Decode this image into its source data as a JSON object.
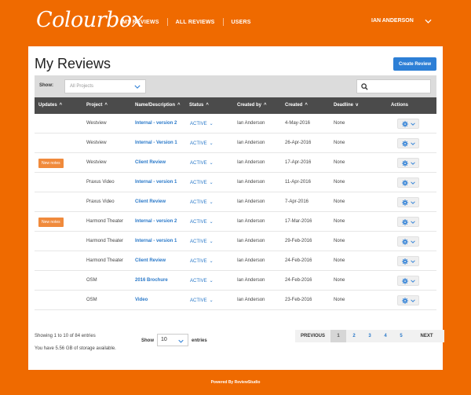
{
  "brand": {
    "logo": "Colourbox"
  },
  "nav": {
    "items": [
      {
        "label": "MY REVIEWS"
      },
      {
        "label": "ALL REVIEWS"
      },
      {
        "label": "USERS"
      }
    ],
    "user_name": "IAN ANDERSON"
  },
  "page": {
    "title": "My Reviews",
    "create_button": "Create Review"
  },
  "filter": {
    "show_label": "Show:",
    "project_placeholder": "All Projects"
  },
  "table": {
    "headers": {
      "updates": "Updates",
      "project": "Project",
      "name": "Name/Description",
      "status": "Status",
      "created_by": "Created by",
      "created": "Created",
      "deadline": "Deadline",
      "actions": "Actions"
    },
    "rows": [
      {
        "badge": "",
        "project": "Westview",
        "name": "Internal - version 2",
        "status": "ACTIVE",
        "created_by": "Ian Anderson",
        "created": "4-May-2016",
        "deadline": "None"
      },
      {
        "badge": "",
        "project": "Westview",
        "name": "Internal - Version 1",
        "status": "ACTIVE",
        "created_by": "Ian Anderson",
        "created": "26-Apr-2016",
        "deadline": "None"
      },
      {
        "badge": "New notes",
        "project": "Westview",
        "name": "Client Review",
        "status": "ACTIVE",
        "created_by": "Ian Anderson",
        "created": "17-Apr-2016",
        "deadline": "None"
      },
      {
        "badge": "",
        "project": "Praxus Video",
        "name": "Internal - version 1",
        "status": "ACTIVE",
        "created_by": "Ian Anderson",
        "created": "11-Apr-2016",
        "deadline": "None"
      },
      {
        "badge": "",
        "project": "Praxus Video",
        "name": "Client Review",
        "status": "ACTIVE",
        "created_by": "Ian Anderson",
        "created": "7-Apr-2016",
        "deadline": "None"
      },
      {
        "badge": "New notes",
        "project": "Harmond Theater",
        "name": "Internal - version 2",
        "status": "ACTIVE",
        "created_by": "Ian Anderson",
        "created": "17-Mar-2016",
        "deadline": "None"
      },
      {
        "badge": "",
        "project": "Harmond Theater",
        "name": "Internal - version 1",
        "status": "ACTIVE",
        "created_by": "Ian Anderson",
        "created": "29-Feb-2016",
        "deadline": "None"
      },
      {
        "badge": "",
        "project": "Harmond Theater",
        "name": "Client Review",
        "status": "ACTIVE",
        "created_by": "Ian Anderson",
        "created": "24-Feb-2016",
        "deadline": "None"
      },
      {
        "badge": "",
        "project": "OSM",
        "name": "2016 Brochure",
        "status": "ACTIVE",
        "created_by": "Ian Anderson",
        "created": "24-Feb-2016",
        "deadline": "None"
      },
      {
        "badge": "",
        "project": "OSM",
        "name": "Video",
        "status": "ACTIVE",
        "created_by": "Ian Anderson",
        "created": "23-Feb-2016",
        "deadline": "None"
      }
    ]
  },
  "footer": {
    "entries_info": "Showing 1 to 10 of 84 entries",
    "storage_info": "You have 5.56 GB of storage available.",
    "show_label": "Show",
    "page_size": "10",
    "entries_label": "entries",
    "pagination": {
      "previous": "PREVIOUS",
      "pages": [
        "1",
        "2",
        "3",
        "4",
        "5"
      ],
      "active_page": "1",
      "next": "NEXT"
    }
  },
  "powered_by": "Powered By ReviewStudio",
  "colors": {
    "background": "#ef6a00",
    "primary": "#2d7fd6",
    "link": "#2a79c9",
    "badge": "#f08a3c",
    "table_header": "#4b4b4b"
  }
}
